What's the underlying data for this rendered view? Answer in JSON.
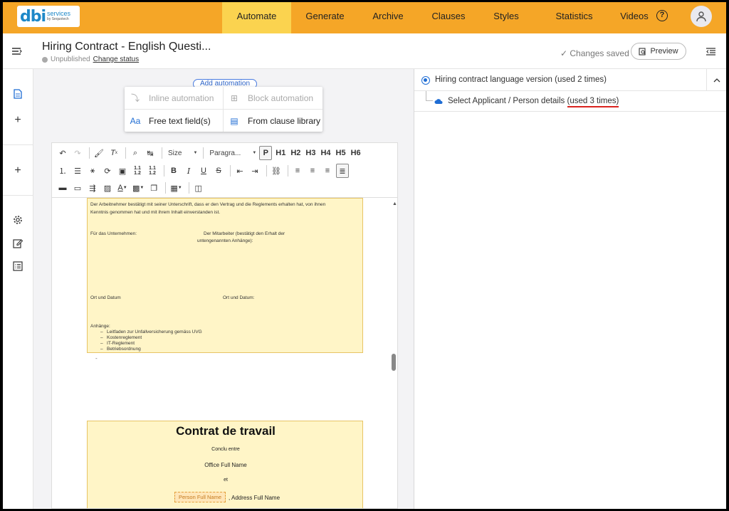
{
  "brand": {
    "logo_main": "dbi",
    "logo_line1": "services",
    "logo_line2": "by Sequotech",
    "accent": "#f5a627",
    "active_tab": "#fbd34f"
  },
  "nav": {
    "items": [
      {
        "label": "Automate",
        "active": true
      },
      {
        "label": "Generate"
      },
      {
        "label": "Archive"
      },
      {
        "label": "Clauses"
      },
      {
        "label": "Styles"
      },
      {
        "label": "Statistics"
      },
      {
        "label": "Videos"
      }
    ],
    "help_symbol": "?"
  },
  "header": {
    "title": "Hiring Contract - English Questi...",
    "status": "Unpublished",
    "change_status": "Change status",
    "saved": "Changes saved",
    "preview": "Preview"
  },
  "automation": {
    "add_label": "Add automation",
    "menu": [
      {
        "label": "Inline automation",
        "icon": "inline-automation-icon",
        "enabled": false
      },
      {
        "label": "Block automation",
        "icon": "block-automation-icon",
        "enabled": false
      },
      {
        "label": "Free text field(s)",
        "icon": "free-text-icon",
        "enabled": true
      },
      {
        "label": "From clause library",
        "icon": "clause-library-icon",
        "enabled": true
      }
    ]
  },
  "toolbar": {
    "size_label": "Size",
    "paragraph_label": "Paragra...",
    "headings": [
      "P",
      "H1",
      "H2",
      "H3",
      "H4",
      "H5",
      "H6"
    ]
  },
  "document": {
    "page1": {
      "line1": "Der Arbeitnehmer bestätigt mit seiner Unterschrift, dass er den Vertrag und die Reglements erhalten hat, von ihnen",
      "line2": "Kenntnis genommen hat und mit ihrem Inhalt einverstanden ist.",
      "company": "Für das Unternehmen:",
      "employee1": "Der Mitarbeiter (bestätigt den Erhalt der",
      "employee2": "untengenannten Anhänge):",
      "place1": "Ort und Datum",
      "place2": "Ort und Datum:",
      "annex_title": "Anhänge:",
      "annexes": [
        "Leitfaden zur Unfallversicherung gemäss UVG",
        "Kostenreglement",
        "IT-Reglement",
        "Betriebsordnung"
      ]
    },
    "page2": {
      "heading": "Contrat de travail",
      "concluded": "Conclu entre",
      "office": "Office Full Name",
      "and": "et",
      "person_tag": "Person Full Name",
      "address": ", Address Full Name"
    }
  },
  "panel": {
    "lang_version": "Hiring contract language version (used 2 times)",
    "applicant_prefix": "Select Applicant / Person details ",
    "applicant_used": "(used 3 times)"
  }
}
